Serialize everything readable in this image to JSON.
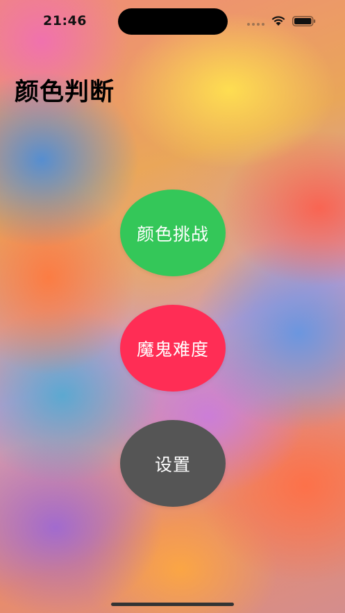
{
  "status_bar": {
    "time": "21:46",
    "wifi_icon": "wifi-icon",
    "battery_icon": "battery-icon",
    "signal_icon": "cellular-signal-icon"
  },
  "page": {
    "title": "颜色判断"
  },
  "buttons": [
    {
      "label": "颜色挑战",
      "color": "#34C759"
    },
    {
      "label": "魔鬼难度",
      "color": "#FF2D55"
    },
    {
      "label": "设置",
      "color": "#555555"
    }
  ],
  "home_indicator": "home-indicator"
}
